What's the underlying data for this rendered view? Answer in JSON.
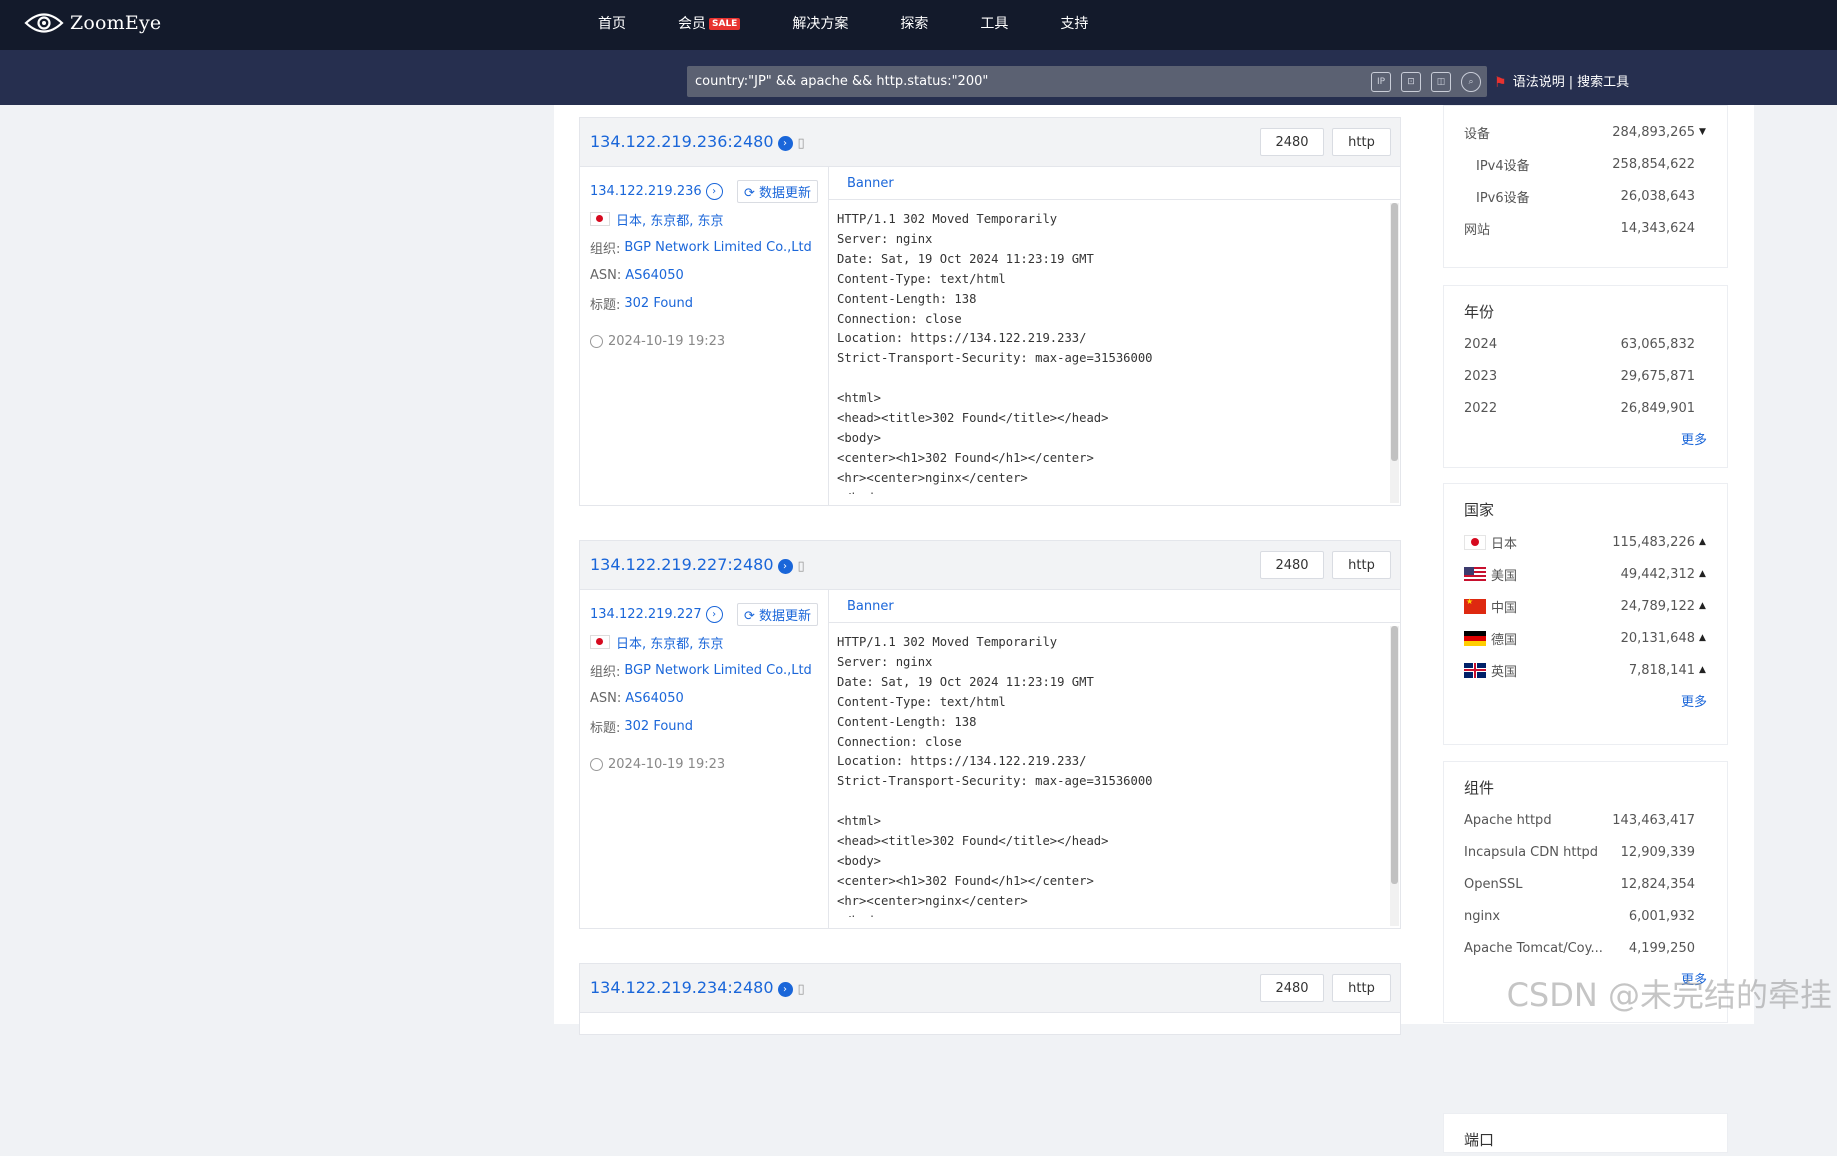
{
  "header": {
    "logo_text": "ZoomEye",
    "nav": [
      "首页",
      "会员",
      "解决方案",
      "探索",
      "工具",
      "支持"
    ],
    "sale_badge": "SALE"
  },
  "search": {
    "query": "country:\"JP\" && apache && http.status:\"200\"",
    "icon_labels": [
      "IP",
      "",
      "",
      ""
    ],
    "link_syntax": "语法说明",
    "link_separator": "|",
    "link_tools": "搜索工具"
  },
  "results": [
    {
      "ip_port": "134.122.219.236:2480",
      "port": "2480",
      "protocol": "http",
      "ip": "134.122.219.236",
      "update_label": "数据更新",
      "location": "日本, 东京都, 东京",
      "org_label": "组织:",
      "org": "BGP Network Limited Co.,Ltd",
      "asn_label": "ASN:",
      "asn": "AS64050",
      "title_label": "标题:",
      "title": "302 Found",
      "time": "2024-10-19 19:23",
      "banner_tab": "Banner",
      "banner": "HTTP/1.1 302 Moved Temporarily\nServer: nginx\nDate: Sat, 19 Oct 2024 11:23:19 GMT\nContent-Type: text/html\nContent-Length: 138\nConnection: close\nLocation: https://134.122.219.233/\nStrict-Transport-Security: max-age=31536000\n\n<html>\n<head><title>302 Found</title></head>\n<body>\n<center><h1>302 Found</h1></center>\n<hr><center>nginx</center>\n</body>"
    },
    {
      "ip_port": "134.122.219.227:2480",
      "port": "2480",
      "protocol": "http",
      "ip": "134.122.219.227",
      "update_label": "数据更新",
      "location": "日本, 东京都, 东京",
      "org_label": "组织:",
      "org": "BGP Network Limited Co.,Ltd",
      "asn_label": "ASN:",
      "asn": "AS64050",
      "title_label": "标题:",
      "title": "302 Found",
      "time": "2024-10-19 19:23",
      "banner_tab": "Banner",
      "banner": "HTTP/1.1 302 Moved Temporarily\nServer: nginx\nDate: Sat, 19 Oct 2024 11:23:19 GMT\nContent-Type: text/html\nContent-Length: 138\nConnection: close\nLocation: https://134.122.219.233/\nStrict-Transport-Security: max-age=31536000\n\n<html>\n<head><title>302 Found</title></head>\n<body>\n<center><h1>302 Found</h1></center>\n<hr><center>nginx</center>\n</body>"
    },
    {
      "ip_port": "134.122.219.234:2480",
      "port": "2480",
      "protocol": "http"
    }
  ],
  "sidebar": {
    "devices": {
      "rows": [
        {
          "label": "设备",
          "value": "284,893,265"
        },
        {
          "label": "IPv4设备",
          "value": "258,854,622"
        },
        {
          "label": "IPv6设备",
          "value": "26,038,643"
        },
        {
          "label": "网站",
          "value": "14,343,624"
        }
      ]
    },
    "year": {
      "title": "年份",
      "rows": [
        {
          "label": "2024",
          "value": "63,065,832"
        },
        {
          "label": "2023",
          "value": "29,675,871"
        },
        {
          "label": "2022",
          "value": "26,849,901"
        }
      ],
      "more": "更多"
    },
    "country": {
      "title": "国家",
      "rows": [
        {
          "label": "日本",
          "value": "115,483,226"
        },
        {
          "label": "美国",
          "value": "49,442,312"
        },
        {
          "label": "中国",
          "value": "24,789,122"
        },
        {
          "label": "德国",
          "value": "20,131,648"
        },
        {
          "label": "英国",
          "value": "7,818,141"
        }
      ],
      "more": "更多"
    },
    "component": {
      "title": "组件",
      "rows": [
        {
          "label": "Apache httpd",
          "value": "143,463,417"
        },
        {
          "label": "Incapsula CDN httpd",
          "value": "12,909,339"
        },
        {
          "label": "OpenSSL",
          "value": "12,824,354"
        },
        {
          "label": "nginx",
          "value": "6,001,932"
        },
        {
          "label": "Apache Tomcat/Coy...",
          "value": "4,199,250"
        }
      ],
      "more": "更多"
    },
    "next_title": "端口"
  },
  "watermark": "CSDN @未完结的牵挂"
}
